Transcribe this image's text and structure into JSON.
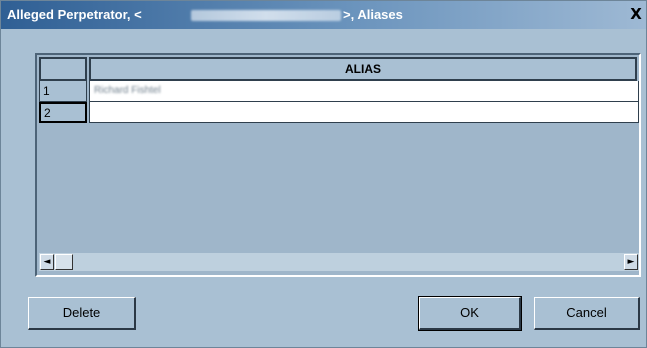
{
  "window": {
    "title_prefix": "Alleged Perpetrator, <",
    "title_suffix": ">, Aliases",
    "close_glyph": "X"
  },
  "grid": {
    "column_header": "ALIAS",
    "rows": [
      {
        "number": "1",
        "alias": "Richard Fishtel"
      },
      {
        "number": "2",
        "alias": ""
      }
    ],
    "scroll_left_glyph": "◄",
    "scroll_right_glyph": "►"
  },
  "buttons": {
    "delete": "Delete",
    "ok": "OK",
    "cancel": "Cancel"
  }
}
